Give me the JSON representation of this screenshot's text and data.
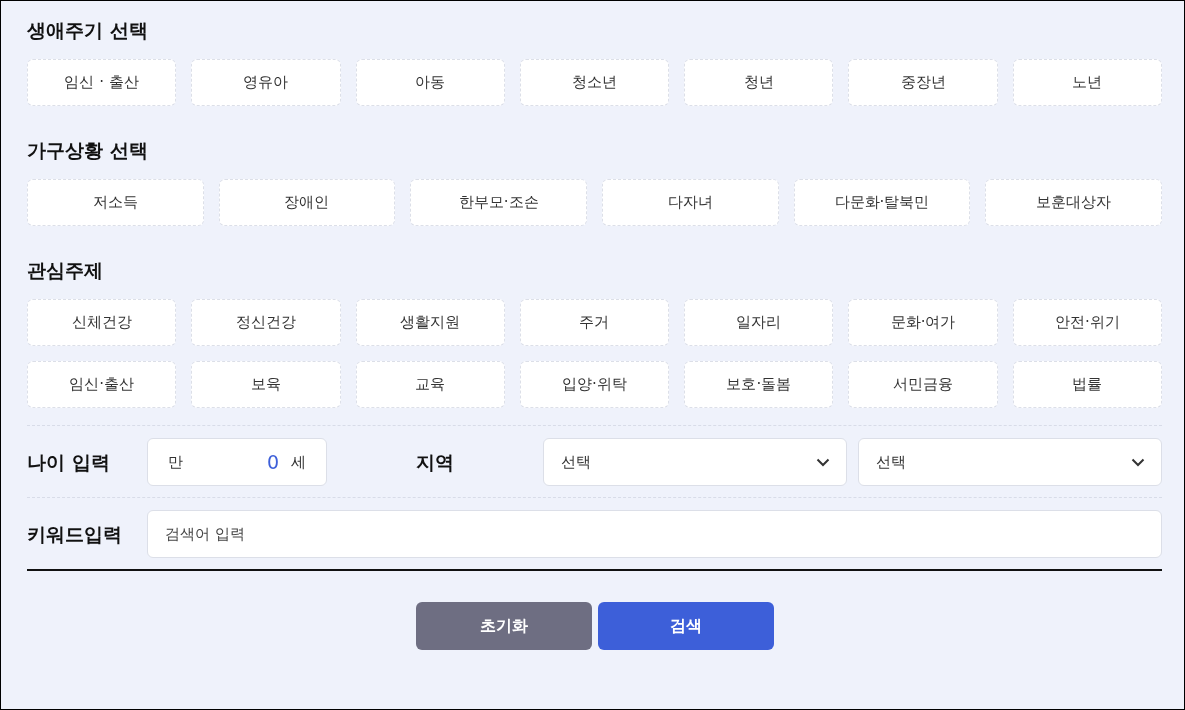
{
  "sections": [
    {
      "title": "생애주기 선택",
      "chips": [
        {
          "label": "임신 · 출산",
          "selected": false
        },
        {
          "label": "영유아",
          "selected": false
        },
        {
          "label": "아동",
          "selected": false
        },
        {
          "label": "청소년",
          "selected": false
        },
        {
          "label": "청년",
          "selected": false
        },
        {
          "label": "중장년",
          "selected": false
        },
        {
          "label": "노년",
          "selected": false
        }
      ]
    },
    {
      "title": "가구상황 선택",
      "chips": [
        {
          "label": "저소득",
          "selected": false
        },
        {
          "label": "장애인",
          "selected": false
        },
        {
          "label": "한부모·조손",
          "selected": false
        },
        {
          "label": "다자녀",
          "selected": false
        },
        {
          "label": "다문화·탈북민",
          "selected": false
        },
        {
          "label": "보훈대상자",
          "selected": false
        }
      ]
    },
    {
      "title": "관심주제",
      "chips": [
        {
          "label": "신체건강",
          "selected": false
        },
        {
          "label": "정신건강",
          "selected": false
        },
        {
          "label": "생활지원",
          "selected": false
        },
        {
          "label": "주거",
          "selected": false
        },
        {
          "label": "일자리",
          "selected": false
        },
        {
          "label": "문화·여가",
          "selected": false
        },
        {
          "label": "안전·위기",
          "selected": false
        },
        {
          "label": "임신·출산",
          "selected": false
        },
        {
          "label": "보육",
          "selected": false
        },
        {
          "label": "교육",
          "selected": false
        },
        {
          "label": "입양·위탁",
          "selected": false
        },
        {
          "label": "보호·돌봄",
          "selected": false
        },
        {
          "label": "서민금융",
          "selected": false
        },
        {
          "label": "법률",
          "selected": false
        }
      ]
    }
  ],
  "age": {
    "label": "나이 입력",
    "prefix": "만",
    "value": "0",
    "suffix": "세"
  },
  "region": {
    "label": "지역",
    "selects": [
      {
        "value": "선택"
      },
      {
        "value": "선택"
      }
    ]
  },
  "keyword": {
    "label": "키워드입력",
    "placeholder": "검색어 입력"
  },
  "buttons": [
    {
      "label": "초기화",
      "kind": "reset"
    },
    {
      "label": "검색",
      "kind": "search"
    }
  ]
}
